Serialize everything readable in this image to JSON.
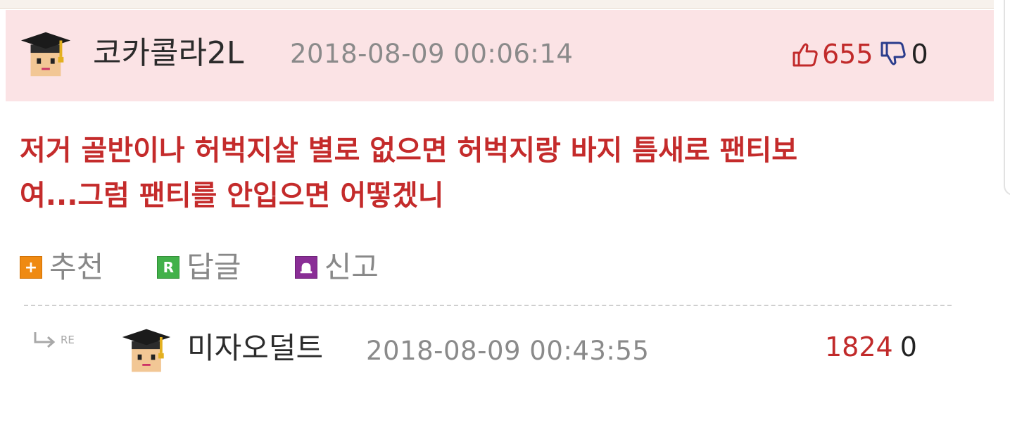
{
  "comment": {
    "nickname": "코카콜라2L",
    "timestamp": "2018-08-09 00:06:14",
    "upvotes": "655",
    "downvotes": "0",
    "body_line1": "저거 골반이나 허벅지살 별로 없으면 허벅지랑 바지 틈새로 팬티보",
    "body_line2": "여...그럼 팬티를 안입으면 어떻겠니",
    "actions": {
      "recommend_icon": "+",
      "recommend_label": "추천",
      "reply_icon": "R",
      "reply_label": "답글",
      "report_label": "신고"
    },
    "colors": {
      "header_bg": "#fbe3e5",
      "body_text": "#c42b2b",
      "recommend": "#ef8a12",
      "reply": "#42b14a",
      "report": "#8a2e96"
    }
  },
  "reply": {
    "re_label": "RE",
    "nickname": "미자오덜트",
    "timestamp": "2018-08-09 00:43:55",
    "upvotes": "1824",
    "downvotes": "0"
  },
  "icons": {
    "avatar": "graduate-avatar-icon",
    "upvote": "thumbs-up-icon",
    "downvote": "thumbs-down-icon",
    "reply_arrow": "reply-arrow-icon",
    "report": "siren-icon"
  }
}
